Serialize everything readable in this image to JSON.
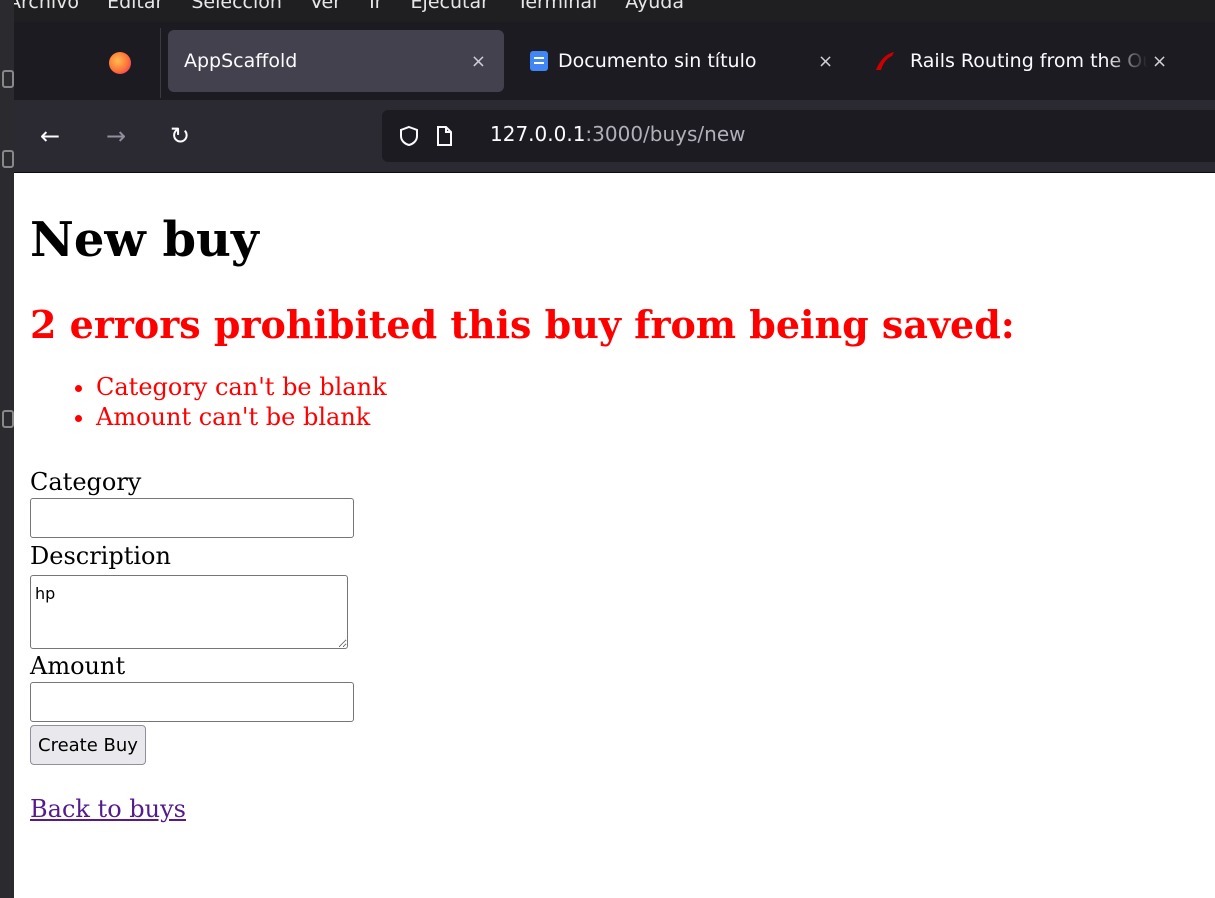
{
  "os_menu": [
    "Archivo",
    "Editar",
    "Selección",
    "Ver",
    "Ir",
    "Ejecutar",
    "Terminal",
    "Ayuda"
  ],
  "tabs": [
    {
      "title": "AppScaffold",
      "active": true
    },
    {
      "title": "Documento sin título",
      "active": false
    },
    {
      "title": "Rails Routing from the Outside In",
      "active": false
    }
  ],
  "tab_close_glyph": "×",
  "nav": {
    "back": "←",
    "forward": "→",
    "reload": "↻"
  },
  "address": {
    "host": "127.0.0.1",
    "rest": ":3000/buys/new"
  },
  "page": {
    "title": "New buy",
    "error_heading": "2 errors prohibited this buy from being saved:",
    "errors": [
      "Category can't be blank",
      "Amount can't be blank"
    ],
    "fields": {
      "category_label": "Category",
      "category_value": "",
      "description_label": "Description",
      "description_value": "hp",
      "amount_label": "Amount",
      "amount_value": ""
    },
    "submit_label": "Create Buy",
    "back_link": "Back to buys"
  },
  "colors": {
    "error": "#ff0000",
    "visited_link": "#551a8b",
    "tab_active": "#42414d",
    "chrome_bg": "#1c1b22"
  }
}
